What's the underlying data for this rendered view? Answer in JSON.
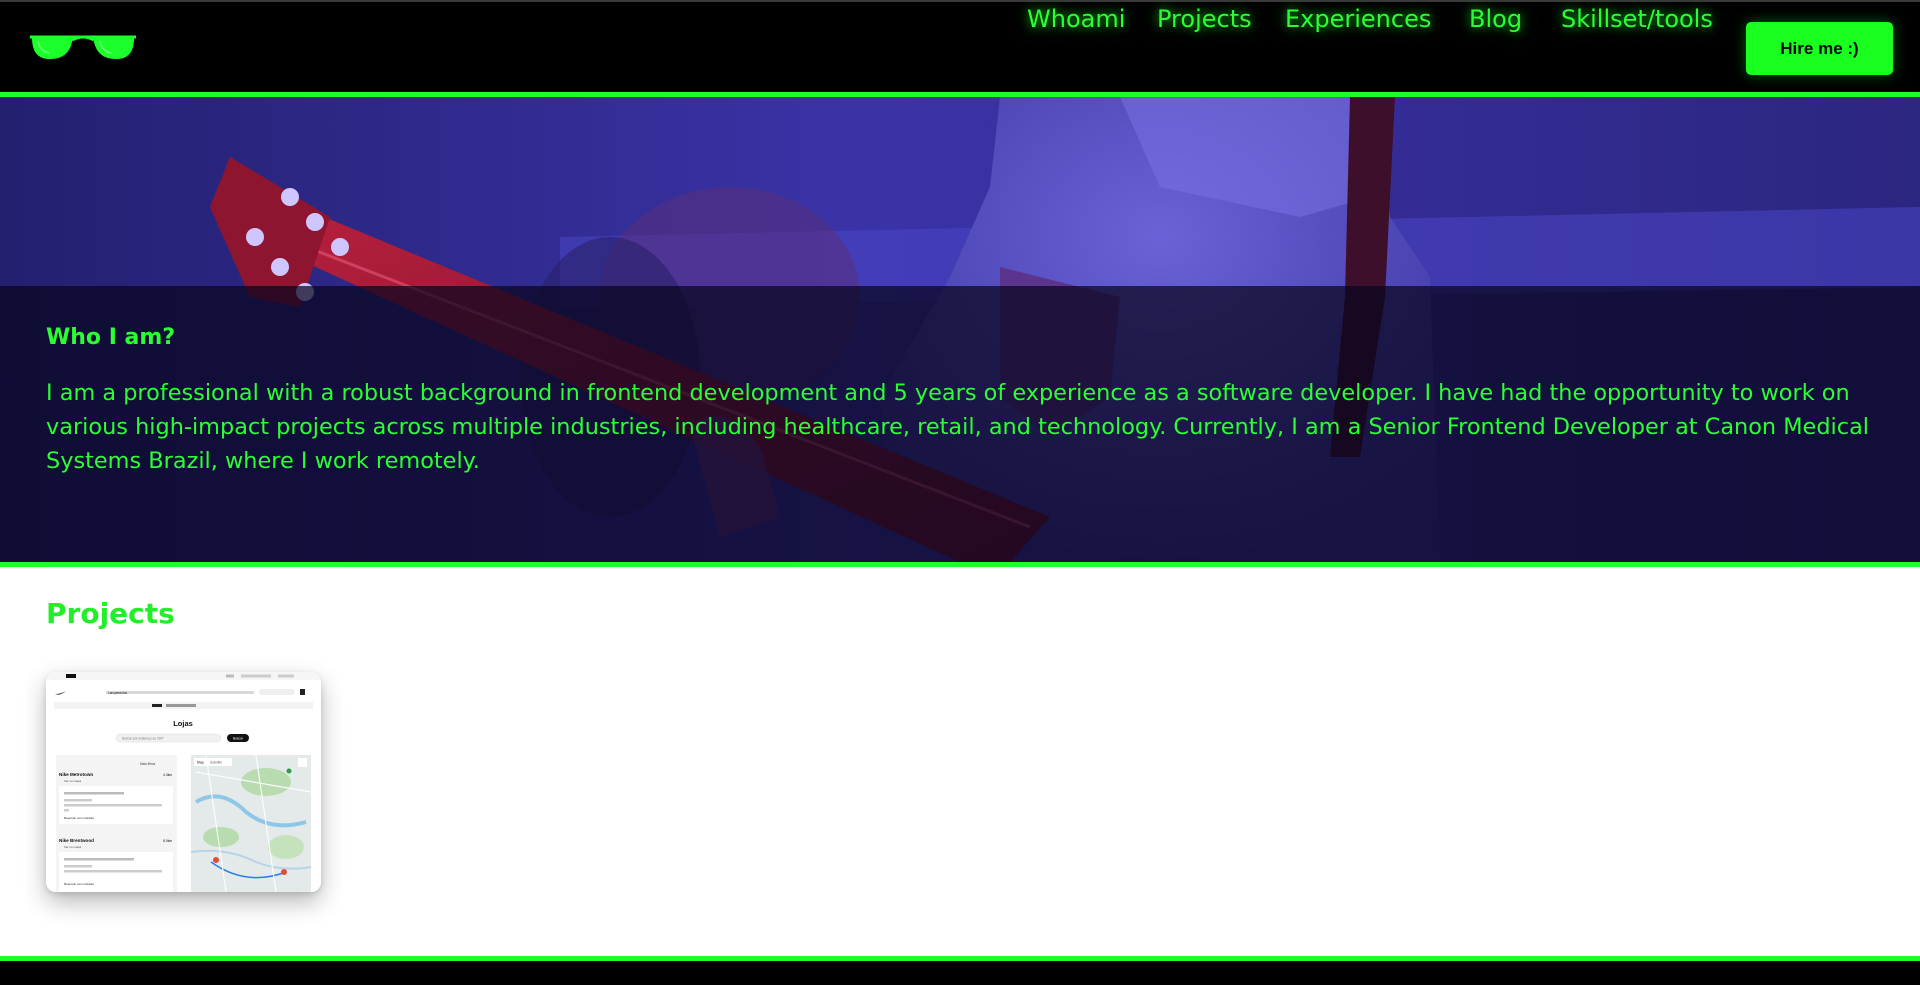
{
  "header": {
    "nav": [
      {
        "label": "Whoami"
      },
      {
        "label": "Projects"
      },
      {
        "label": "Experiences"
      },
      {
        "label": "Blog"
      },
      {
        "label": "Skillset/tools"
      }
    ],
    "hire_label": "Hire me :)"
  },
  "about": {
    "title": "Who I am?",
    "text": "I am a professional with a robust background in frontend development and 5 years of experience as a software developer. I have had the opportunity to work on various high-impact projects across multiple industries, including healthcare, retail, and technology. Currently, I am a Senior Frontend Developer at Canon Medical Systems Brazil, where I work remotely."
  },
  "projects": {
    "title": "Projects",
    "card": {
      "page_heading": "Lojas",
      "search_placeholder": "Buscar por endereço ou CEP",
      "search_button": "Buscar",
      "more_filters": "Mais filtros",
      "map_tabs": [
        "Map",
        "Satellite"
      ],
      "stores": [
        {
          "name": "Nike Metrotown",
          "distance": "4.3km",
          "link": "Ver no mapa",
          "action": "Reservar com retirada"
        },
        {
          "name": "Nike Brentwood",
          "distance": "8.9km",
          "link": "Ver no mapa",
          "action": "Reservar com retirada"
        }
      ],
      "nav_items": [
        "Lançamentos",
        "Masculino",
        "Feminino",
        "Infantil",
        "Ofertas",
        "Lançamentos",
        "SNKRS"
      ]
    }
  },
  "colors": {
    "accent": "#1bff2a",
    "header_bg": "#000000",
    "button_text": "#0a0a0a"
  },
  "icons": {
    "logo": "sunglasses-icon"
  }
}
